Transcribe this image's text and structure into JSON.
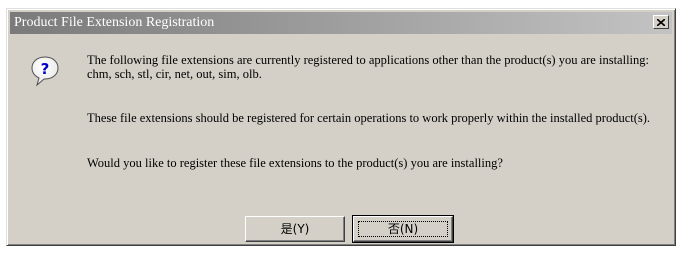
{
  "window": {
    "title": "Product File Extension Registration",
    "close_icon": "close-icon"
  },
  "message": {
    "icon": "question-icon",
    "line1": "The following file extensions are currently registered to applications other than the product(s) you are installing:",
    "line1_extensions": "chm, sch, stl, cir, net, out, sim, olb.",
    "line2": "These file extensions should be registered for certain operations to work properly within the installed product(s).",
    "line3": "Would you like to register these file extensions to the product(s) you are installing?"
  },
  "buttons": {
    "yes_label": "是(Y)",
    "no_label": "否(N)"
  }
}
